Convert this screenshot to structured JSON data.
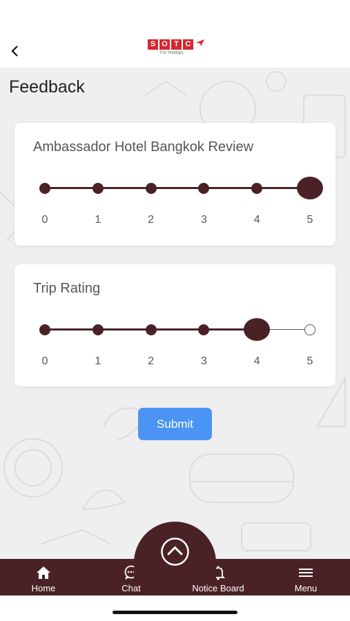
{
  "header": {
    "logo_letters": [
      "S",
      "O",
      "T",
      "C"
    ],
    "logo_tagline": "For Holidays"
  },
  "page": {
    "title": "Feedback"
  },
  "colors": {
    "brand_maroon": "#4a2226",
    "accent_blue": "#4a94f3",
    "logo_red": "#d8262f",
    "background": "#efefef"
  },
  "ratings": [
    {
      "label": "Ambassador Hotel Bangkok Review",
      "value": 5,
      "scale": [
        "0",
        "1",
        "2",
        "3",
        "4",
        "5"
      ]
    },
    {
      "label": "Trip Rating",
      "value": 4,
      "scale": [
        "0",
        "1",
        "2",
        "3",
        "4",
        "5"
      ]
    }
  ],
  "submit_label": "Submit",
  "fab_icon": "chevron-up-icon",
  "tabbar": {
    "items": [
      {
        "label": "Home",
        "icon": "home-icon"
      },
      {
        "label": "Chat",
        "icon": "chat-icon"
      },
      {
        "label": "Notice Board",
        "icon": "bell-icon"
      },
      {
        "label": "Menu",
        "icon": "menu-icon"
      }
    ]
  }
}
